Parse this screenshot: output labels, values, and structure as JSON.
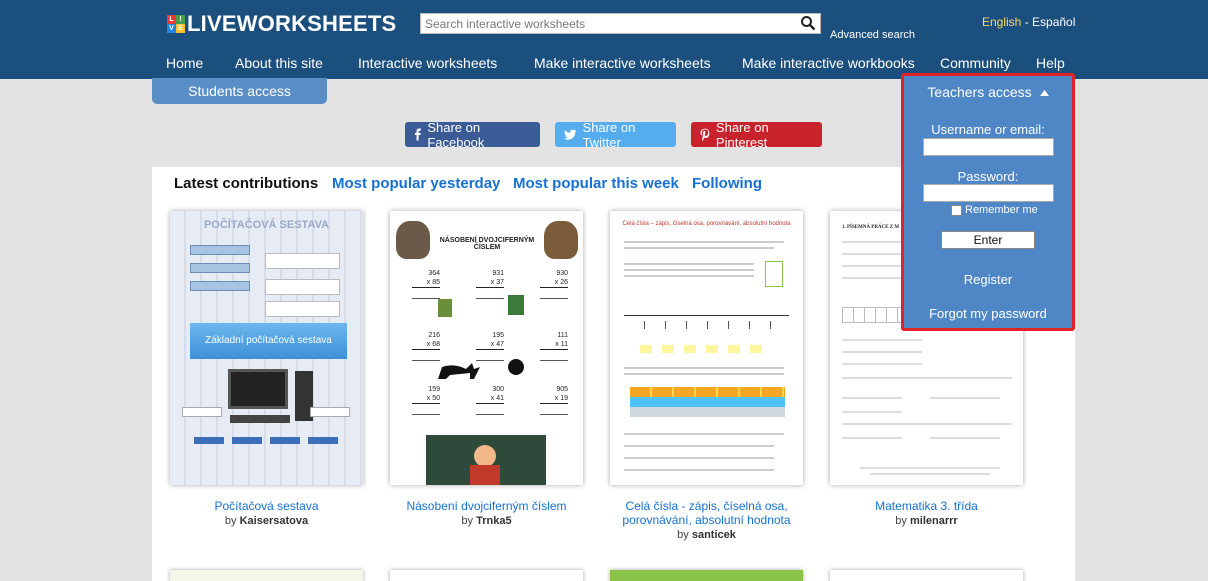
{
  "header": {
    "logo_text": "LIVEWORKSHEETS",
    "logo_mark": [
      "L",
      "I",
      "V",
      "E"
    ],
    "search_placeholder": "Search interactive worksheets",
    "advanced_search": "Advanced search",
    "lang_english": "English",
    "lang_sep": " - ",
    "lang_spanish": "Español",
    "nav": [
      {
        "label": "Home"
      },
      {
        "label": "About this site"
      },
      {
        "label": "Interactive worksheets"
      },
      {
        "label": "Make interactive worksheets"
      },
      {
        "label": "Make interactive workbooks"
      },
      {
        "label": "Community"
      },
      {
        "label": "Help"
      }
    ]
  },
  "students_access": "Students access",
  "share": {
    "facebook": "Share on Facebook",
    "twitter": "Share on Twitter",
    "pinterest": "Share on Pinterest"
  },
  "tabs": {
    "latest": "Latest contributions",
    "yesterday": "Most popular yesterday",
    "week": "Most popular this week",
    "following": "Following"
  },
  "cards": [
    {
      "thumb_title": "POČÍTAČOVÁ SESTAVA",
      "thumb_sub": "Základní počítačová sestava",
      "title": "Počítačová sestava",
      "by": "by",
      "author": "Kaisersatova"
    },
    {
      "thumb_title": "NÁSOBENÍ DVOJCIFERNÝM ČÍSLEM",
      "title": "Násobení dvojciferným číslem",
      "by": "by",
      "author": "Trnka5",
      "problems": [
        [
          "364",
          "x 85"
        ],
        [
          "931",
          "x 37"
        ],
        [
          "930",
          "x 26"
        ],
        [
          "216",
          "x 68"
        ],
        [
          "195",
          "x 47"
        ],
        [
          "111",
          "x 11"
        ],
        [
          "159",
          "x 50"
        ],
        [
          "300",
          "x 41"
        ],
        [
          "905",
          "x 19"
        ]
      ]
    },
    {
      "thumb_title": "Celá čísla – zápis, číselná osa, porovnávání, absolutní hodnota",
      "title": "Celá čísla - zápis, číselná osa, porovnávání, absolutní hodnota",
      "by": "by",
      "author": "santicek"
    },
    {
      "thumb_title": "1. PÍSEMNÁ PRÁCE Z M",
      "title": "Matematika 3. třída",
      "by": "by",
      "author": "milenarrr"
    }
  ],
  "teachers": {
    "title": "Teachers access",
    "username_label": "Username or email:",
    "password_label": "Password:",
    "remember": "Remember me",
    "enter": "Enter",
    "register": "Register",
    "forgot": "Forgot my password"
  },
  "colors": {
    "header_bg": "#1b4f7d",
    "accent_blue": "#4f86c6",
    "link_blue": "#1770d4",
    "highlight_border": "#e0232b",
    "facebook": "#3b5b96",
    "twitter": "#55acee",
    "pinterest": "#c8232c"
  }
}
